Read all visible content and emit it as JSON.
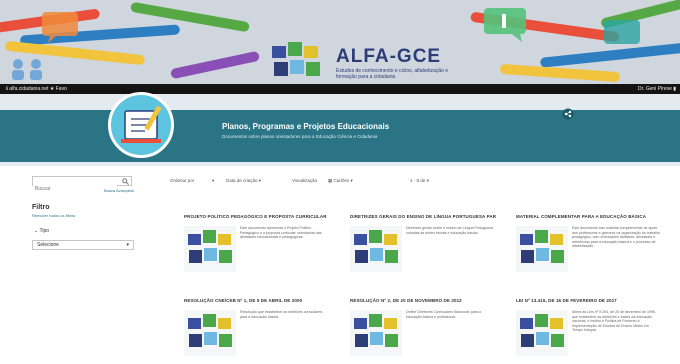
{
  "banner": {
    "logo_text": "ALFA-GCE",
    "logo_subtitle": "Estudos de conhecimento e ciclos, alfabetização e formação para a cidadania"
  },
  "topbar": {
    "left_text": "ℹ  alfa.cidadania.net  ★  Favo",
    "right_text": "Dr. Geni Pirese  ▮"
  },
  "header": {
    "title": "Planos, Programas e Projetos Educacionais",
    "subtitle": "Documentos sobre planos orientadores para a Educação Ciência e Cidadania"
  },
  "sidebar": {
    "search_placeholder": "Buscar",
    "advanced_search": "Busca Avançada",
    "filter_title": "Filtro",
    "filter_clear": "Remover todos os filtros",
    "filter_type_label": "Tipo",
    "filter_select_value": "Selecione"
  },
  "toolbar": {
    "sort_label": "Ordenar por",
    "sort_value": "Data de criação",
    "view_label": "Visualização",
    "view_value": "Cartões",
    "count_text": "1 - 9 de 9"
  },
  "cards": [
    {
      "title": "PROJETO POLÍTICO PEDAGÓGICO E PROPOSTA CURRICULAR",
      "desc": "Este documento apresenta o Projeto Político Pedagógico e a proposta curricular orientadora das atividades educacionais e pedagógicas."
    },
    {
      "title": "DIRETRIZES GERAIS DO ENSINO DE LÍNGUA PORTUGUESA PARA O ENSINO",
      "desc": "Diretrizes gerais sobre o ensino de Língua Portuguesa voltadas às séries iniciais e educação básica."
    },
    {
      "title": "MATERIAL COMPLEMENTAR PARA A EDUCAÇÃO BÁSICA",
      "desc": "Este documento traz material complementar de apoio aos professores e gestores na organização do trabalho pedagógico, com orientações didáticas, atividades e referências para a educação básica e o processo de alfabetização."
    },
    {
      "title": "RESOLUÇÃO CNE/CEB Nº 1, DE 5 DE ABRIL DE 2000",
      "desc": "Resolução que estabelece as diretrizes curriculares para a educação básica."
    },
    {
      "title": "RESOLUÇÃO Nº 2, DE 20 DE NOVEMBRO DE 2012",
      "desc": "Define Diretrizes Curriculares Nacionais para a educação básica e profissional."
    },
    {
      "title": "LEI Nº 13.415, DE 16 DE FEVEREIRO DE 2017",
      "desc": "Altera as Leis nº 9.394, de 20 de dezembro de 1996, que estabelece as diretrizes e bases da educação nacional, e institui a Política de Fomento à Implementação de Escolas de Ensino Médio em Tempo Integral."
    }
  ],
  "colors": {
    "teal": "#2a7486",
    "logo_blue": "#2d3d78",
    "avatar_blue": "#5cc4df"
  }
}
